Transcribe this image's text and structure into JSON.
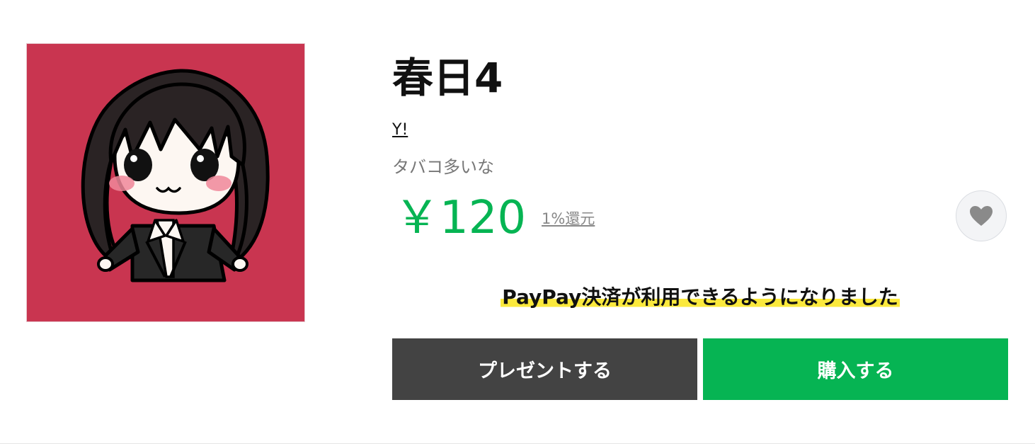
{
  "product": {
    "title": "春日4",
    "author": "Y!",
    "description": "タバコ多いな",
    "price": "￥120",
    "reward": "1%還元"
  },
  "notice": {
    "text": "PayPay決済が利用できるようになりました"
  },
  "actions": {
    "present_label": "プレゼントする",
    "buy_label": "購入する"
  },
  "icons": {
    "favorite": "heart-icon"
  },
  "colors": {
    "accent_green": "#06b453",
    "present_button": "#434343",
    "thumbnail_bg": "#c93550",
    "highlight_yellow": "#fbe93d"
  }
}
